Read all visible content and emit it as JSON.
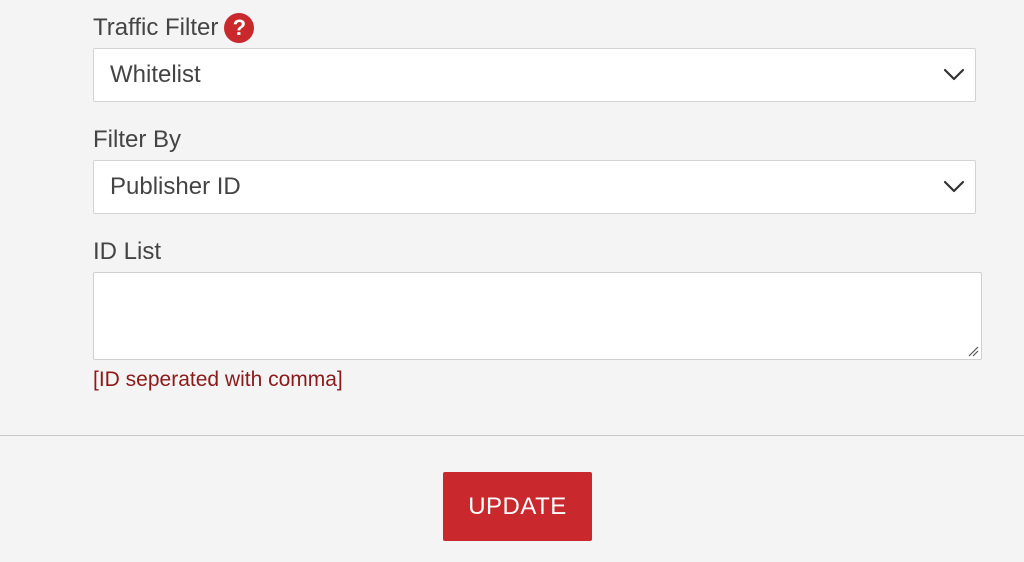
{
  "traffic_filter": {
    "label": "Traffic Filter",
    "help_icon": "question-circle-icon",
    "help_symbol": "?",
    "selected": "Whitelist",
    "chevron_icon": "chevron-down-icon"
  },
  "filter_by": {
    "label": "Filter By",
    "selected": "Publisher ID",
    "chevron_icon": "chevron-down-icon"
  },
  "id_list": {
    "label": "ID List",
    "value": "",
    "hint": "[ID seperated with comma]"
  },
  "actions": {
    "update_label": "UPDATE"
  },
  "colors": {
    "accent": "#c9282d",
    "hint": "#8b1a1a",
    "background": "#f4f4f4",
    "text": "#444444"
  }
}
